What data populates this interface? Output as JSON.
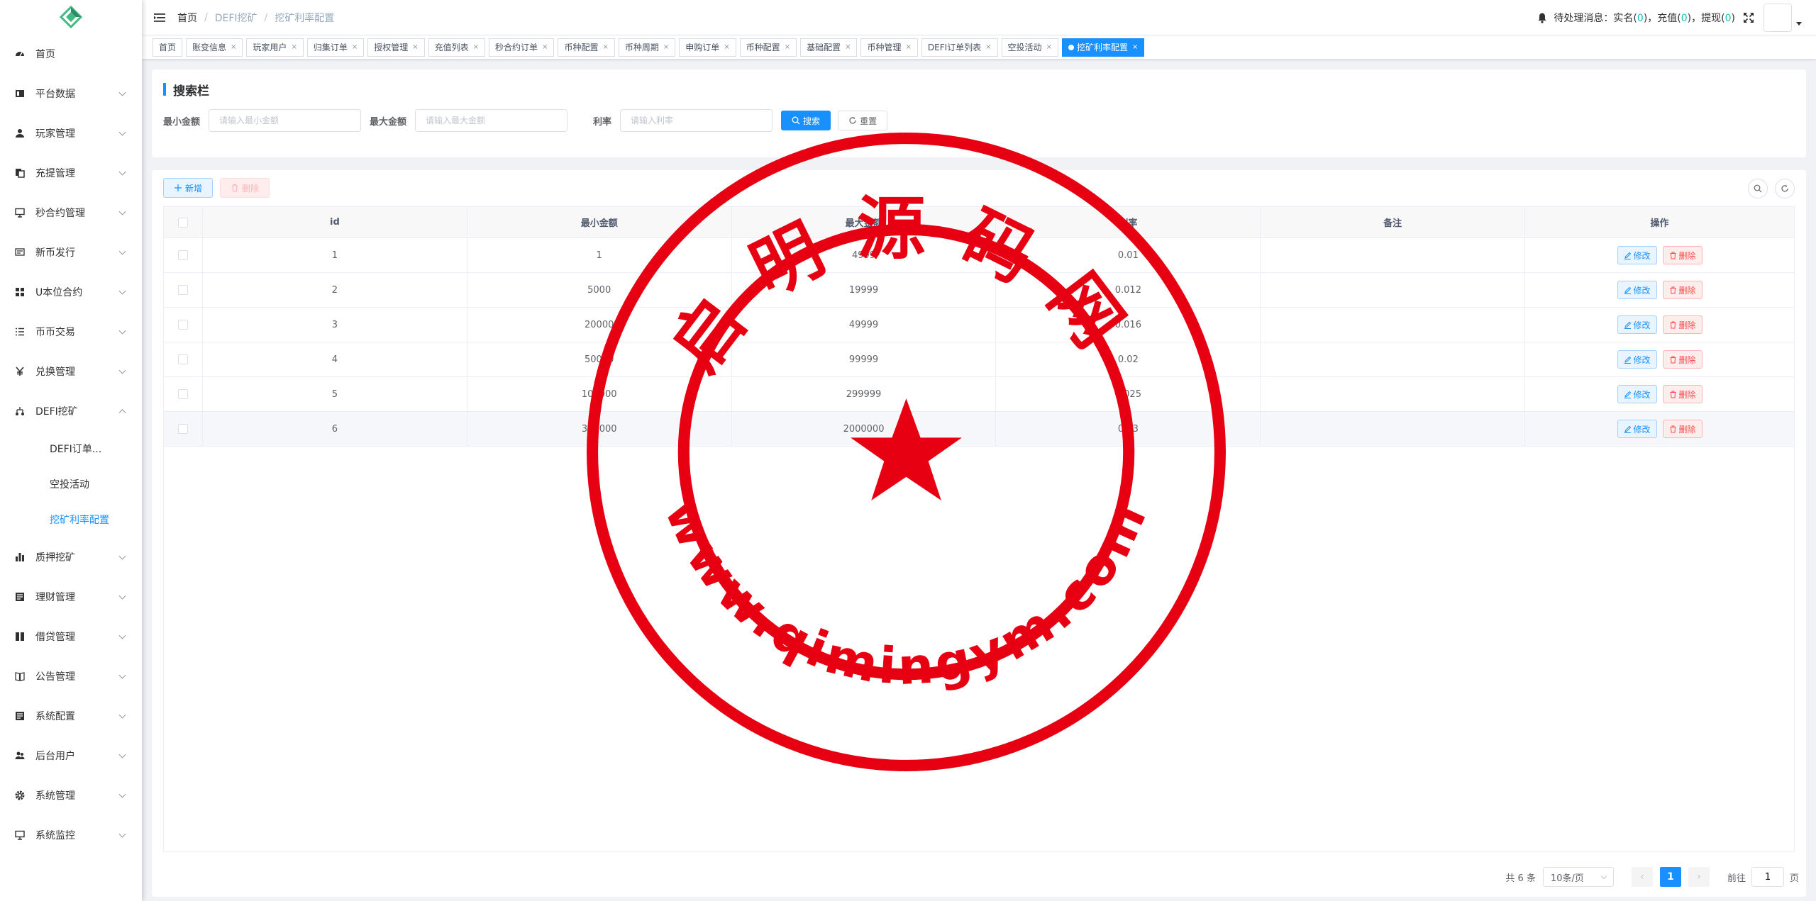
{
  "sidebar": {
    "items": [
      {
        "label": "首页",
        "icon": "dashboard-icon"
      },
      {
        "label": "平台数据",
        "icon": "chart-icon"
      },
      {
        "label": "玩家管理",
        "icon": "user-icon"
      },
      {
        "label": "充提管理",
        "icon": "copy-icon"
      },
      {
        "label": "秒合约管理",
        "icon": "monitor-icon"
      },
      {
        "label": "新币发行",
        "icon": "message-icon"
      },
      {
        "label": "U本位合约",
        "icon": "grid-icon"
      },
      {
        "label": "币币交易",
        "icon": "list-icon"
      },
      {
        "label": "兑换管理",
        "icon": "yen-icon"
      },
      {
        "label": "DEFI挖矿",
        "icon": "tree-icon"
      }
    ],
    "defi_sub": [
      {
        "label": "DEFI订单..."
      },
      {
        "label": "空投活动"
      },
      {
        "label": "挖矿利率配置"
      }
    ],
    "items_after": [
      {
        "label": "质押挖矿",
        "icon": "bar-chart-icon"
      },
      {
        "label": "理财管理",
        "icon": "form-icon"
      },
      {
        "label": "借贷管理",
        "icon": "book-icon"
      },
      {
        "label": "公告管理",
        "icon": "open-book-icon"
      },
      {
        "label": "系统配置",
        "icon": "form-icon"
      },
      {
        "label": "后台用户",
        "icon": "people-icon"
      },
      {
        "label": "系统管理",
        "icon": "gear-icon"
      },
      {
        "label": "系统监控",
        "icon": "monitor-icon"
      }
    ]
  },
  "breadcrumb": [
    "首页",
    "DEFI挖矿",
    "挖矿利率配置"
  ],
  "header": {
    "notice_prefix": "待处理消息：实名(",
    "n1": "0",
    "notice_mid1": ")，充值(",
    "n2": "0",
    "notice_mid2": ")，提现(",
    "n3": "0",
    "notice_suffix": ")"
  },
  "tags": [
    "首页",
    "账变信息",
    "玩家用户",
    "归集订单",
    "授权管理",
    "充值列表",
    "秒合约订单",
    "币种配置",
    "币种周期",
    "申购订单",
    "币种配置",
    "基础配置",
    "币种管理",
    "DEFI订单列表",
    "空投活动"
  ],
  "active_tag": "挖矿利率配置",
  "search": {
    "title": "搜索栏",
    "min_label": "最小金额",
    "min_placeholder": "请输入最小金额",
    "max_label": "最大金额",
    "max_placeholder": "请输入最大金额",
    "rate_label": "利率",
    "rate_placeholder": "请输入利率",
    "search_btn": "搜索",
    "reset_btn": "重置"
  },
  "toolbar": {
    "add_label": "新增",
    "delete_label": "删除"
  },
  "table": {
    "columns": [
      "id",
      "最小金额",
      "最大金额",
      "利率",
      "备注",
      "操作"
    ],
    "rows": [
      {
        "id": "1",
        "min": "1",
        "max": "4999",
        "rate": "0.01",
        "note": ""
      },
      {
        "id": "2",
        "min": "5000",
        "max": "19999",
        "rate": "0.012",
        "note": ""
      },
      {
        "id": "3",
        "min": "20000",
        "max": "49999",
        "rate": "0.016",
        "note": ""
      },
      {
        "id": "4",
        "min": "50000",
        "max": "99999",
        "rate": "0.02",
        "note": ""
      },
      {
        "id": "5",
        "min": "100000",
        "max": "299999",
        "rate": "0.025",
        "note": ""
      },
      {
        "id": "6",
        "min": "300000",
        "max": "2000000",
        "rate": "0.03",
        "note": ""
      }
    ],
    "edit_label": "修改",
    "delete_label": "删除"
  },
  "pagination": {
    "total": "共 6 条",
    "page_size": "10条/页",
    "current": "1",
    "goto_label": "前往",
    "goto_value": "1",
    "page_suffix": "页"
  },
  "watermark": {
    "top_text": "启明源码网",
    "bottom_text": "www.qimingym.com"
  },
  "colors": {
    "primary": "#1890ff",
    "danger": "#ff4949",
    "stamp": "#e60012"
  }
}
